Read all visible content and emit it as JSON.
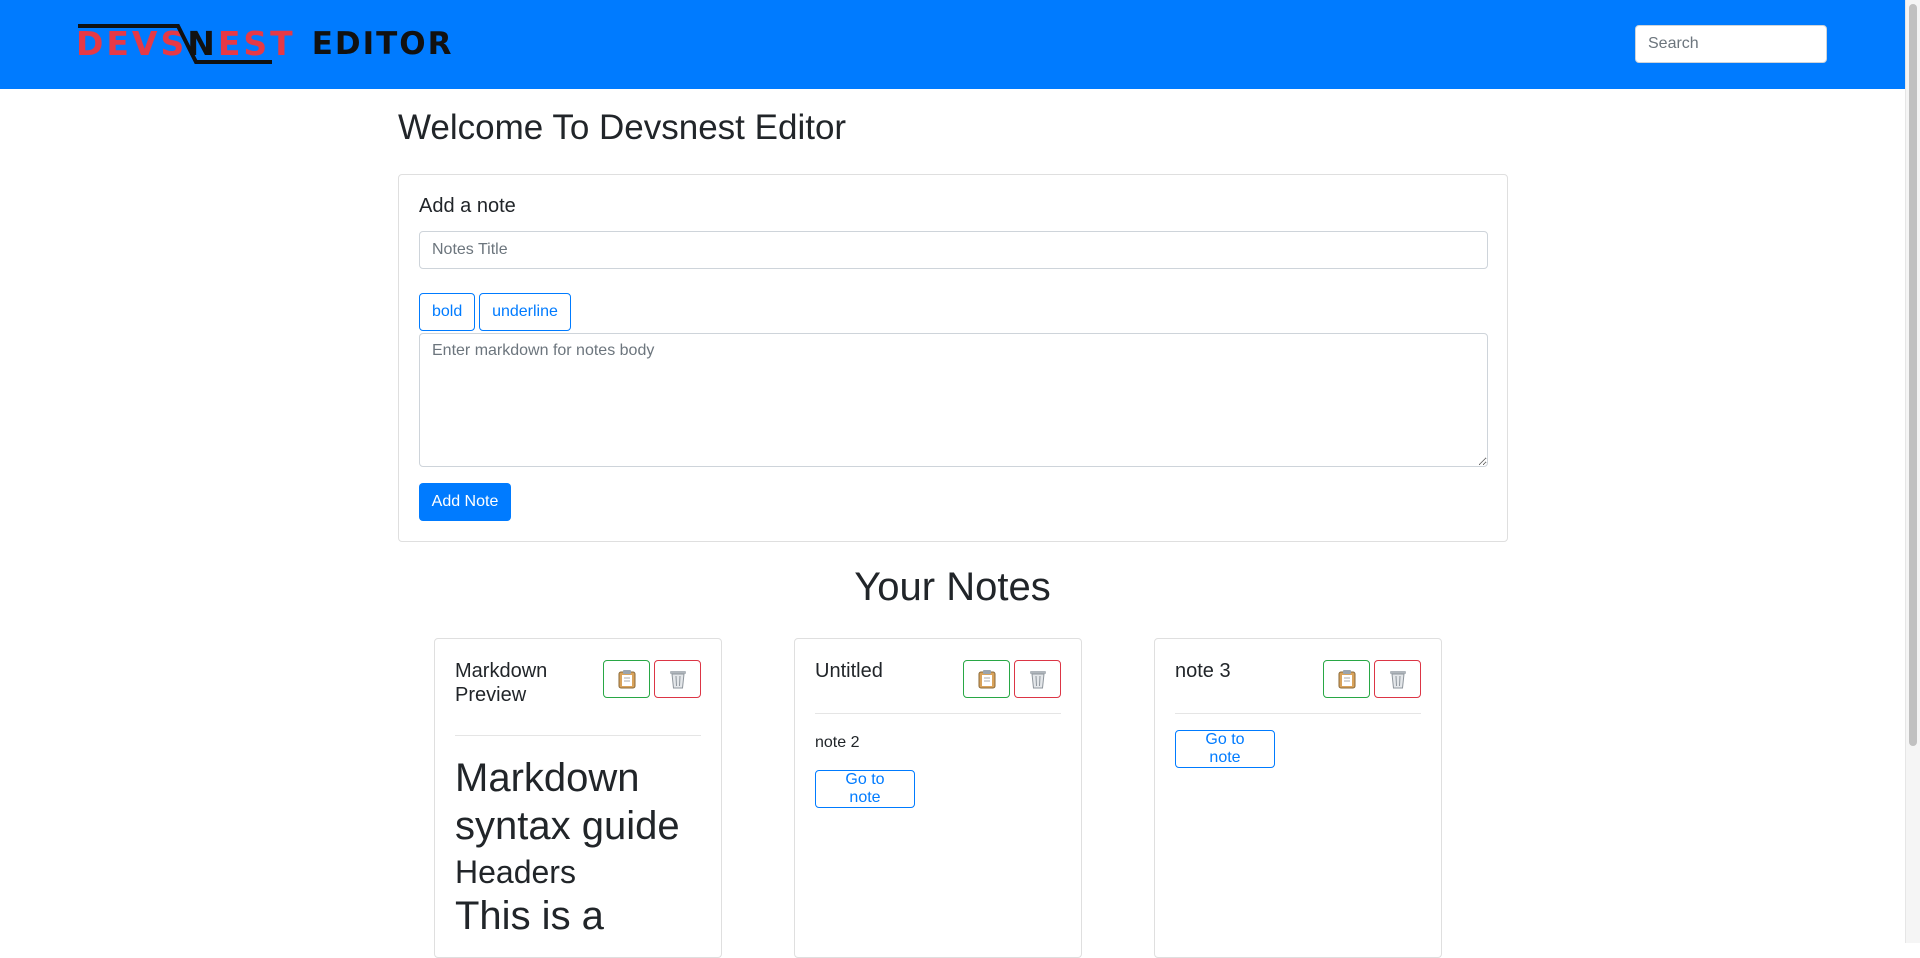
{
  "brand": {
    "logo_part1": "DEVS",
    "logo_part2": "N",
    "logo_part3": "EST",
    "logo_part4": "EDITOR",
    "colors": {
      "navbar": "#007bff",
      "logo_red": "#e63946"
    }
  },
  "search": {
    "placeholder": "Search"
  },
  "page": {
    "welcome_title": "Welcome To Devsnest Editor"
  },
  "add_note": {
    "heading": "Add a note",
    "title_placeholder": "Notes Title",
    "bold_label": "bold",
    "underline_label": "underline",
    "body_placeholder": "Enter markdown for notes body",
    "submit_label": "Add Note"
  },
  "notes_section": {
    "title": "Your Notes"
  },
  "notes": [
    {
      "title": "Markdown Preview",
      "preview_h1": "Markdown syntax guide",
      "preview_h2": "Headers",
      "preview_h1b": "This is a",
      "copy_icon": "clipboard-icon",
      "delete_icon": "trash-icon"
    },
    {
      "title": "Untitled",
      "body": "note 2",
      "go_label": "Go to note",
      "copy_icon": "clipboard-icon",
      "delete_icon": "trash-icon"
    },
    {
      "title": "note 3",
      "go_label": "Go to note",
      "copy_icon": "clipboard-icon",
      "delete_icon": "trash-icon"
    }
  ]
}
